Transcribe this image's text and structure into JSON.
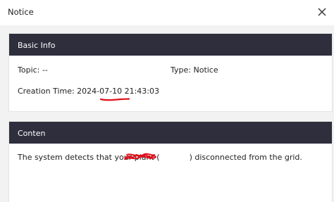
{
  "window": {
    "title": "Notice"
  },
  "basic_info": {
    "header": "Basic Info",
    "topic_label": "Topic:",
    "topic_value": "--",
    "type_label": "Type:",
    "type_value": "Notice",
    "creation_label": "Creation Time:",
    "creation_value": "2024-07-10 21:43:03"
  },
  "content": {
    "header": "Conten",
    "message_before": "The system detects that your plant (",
    "message_after": ") disconnected from the grid."
  },
  "colors": {
    "header_bg": "#2e2e3d",
    "annotation_red": "#e0101c"
  },
  "icons": {
    "close": "close-icon"
  }
}
